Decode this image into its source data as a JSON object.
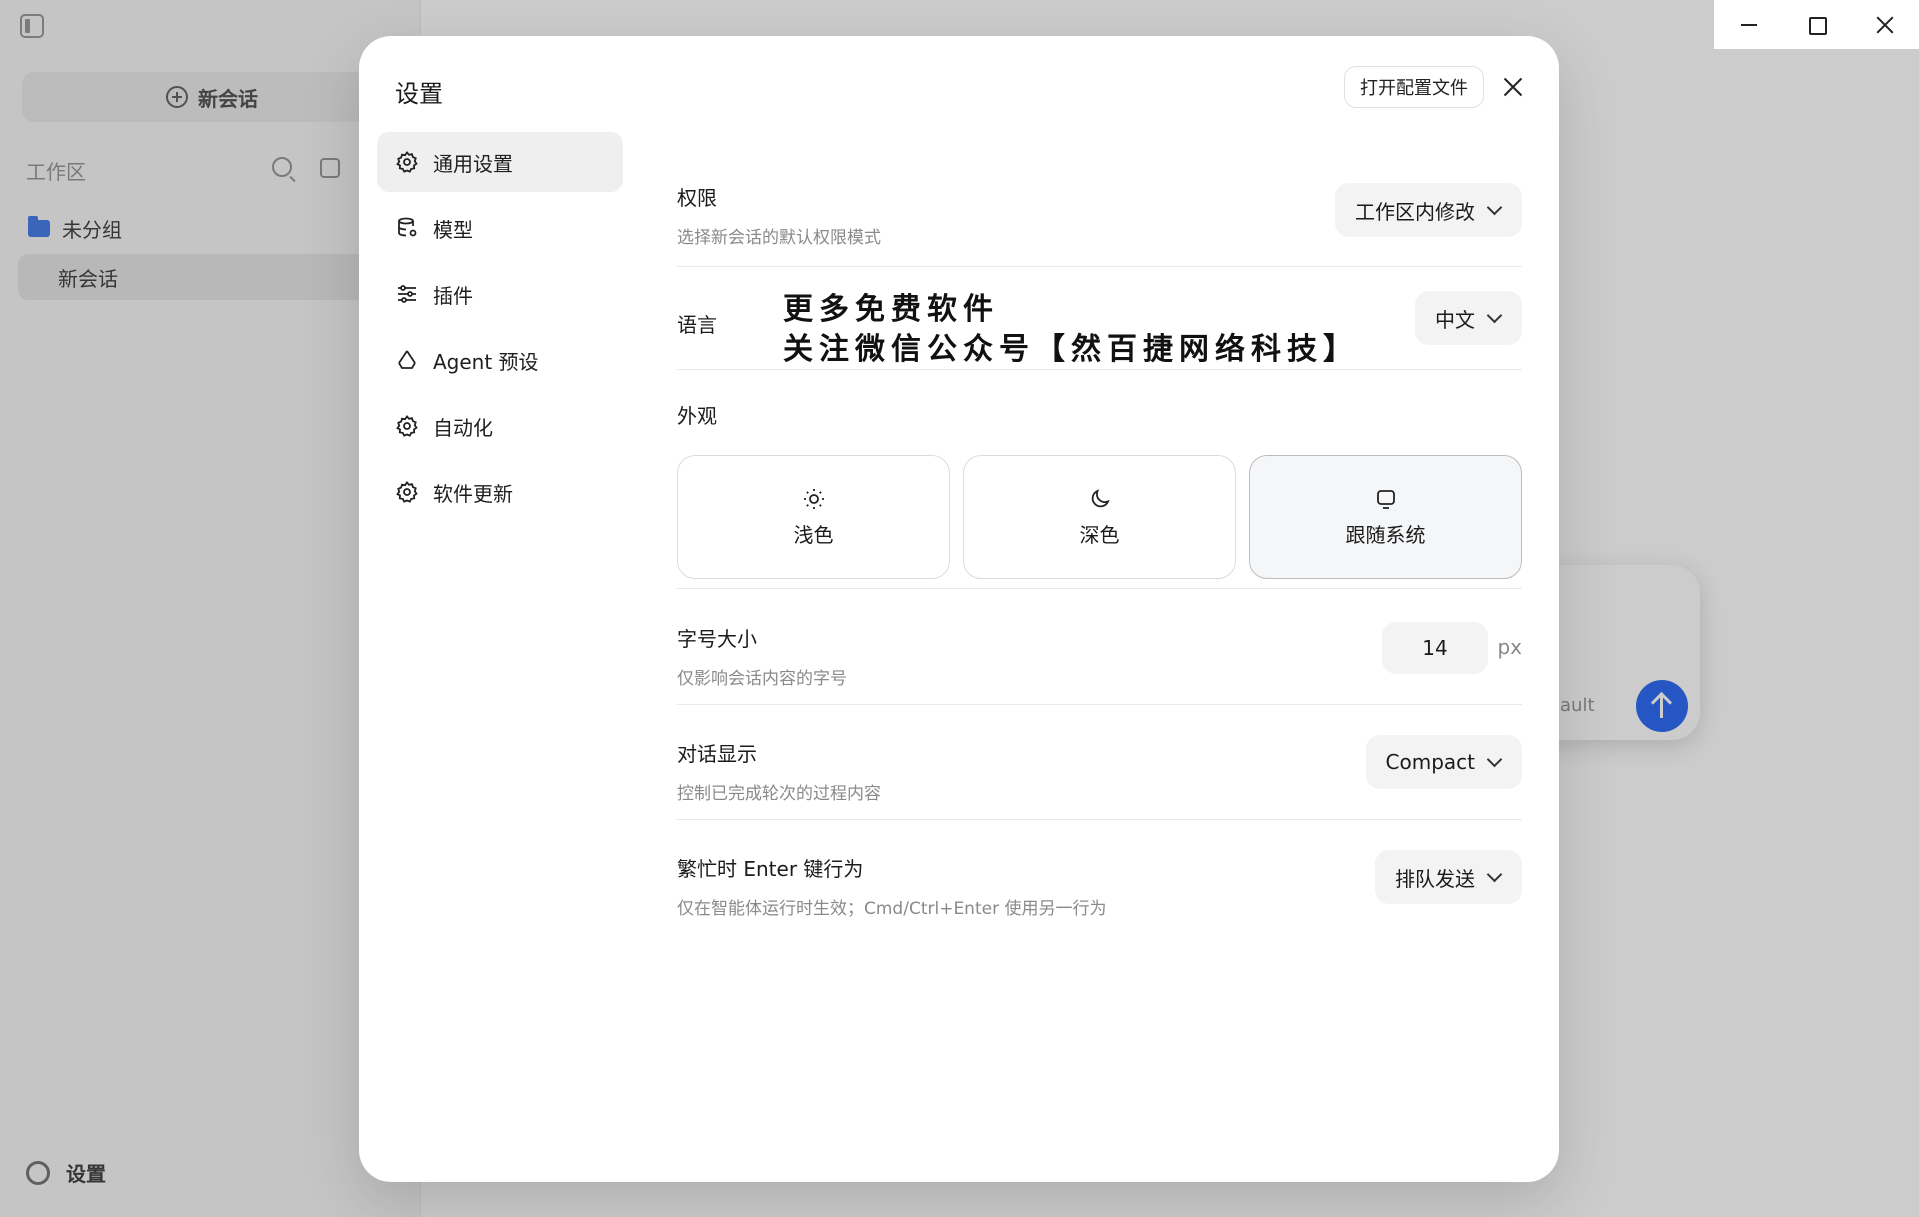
{
  "background": {
    "new_chat_label": "新会话",
    "workspace_label": "工作区",
    "folder_label": "未分组",
    "session_label": "新会话",
    "settings_label": "设置",
    "composer_model_hint": "ault"
  },
  "modal": {
    "title": "设置",
    "open_config_label": "打开配置文件",
    "nav": [
      {
        "label": "通用设置",
        "icon": "gear-icon",
        "active": true
      },
      {
        "label": "模型",
        "icon": "database-icon",
        "active": false
      },
      {
        "label": "插件",
        "icon": "sliders-icon",
        "active": false
      },
      {
        "label": "Agent 预设",
        "icon": "recycle-icon",
        "active": false
      },
      {
        "label": "自动化",
        "icon": "gear-icon",
        "active": false
      },
      {
        "label": "软件更新",
        "icon": "gear-icon",
        "active": false
      }
    ],
    "permissions": {
      "title": "权限",
      "description": "选择新会话的默认权限模式",
      "value": "工作区内修改"
    },
    "language": {
      "title": "语言",
      "value": "中文"
    },
    "appearance": {
      "title": "外观",
      "options": [
        {
          "label": "浅色",
          "icon": "sun-icon",
          "selected": false
        },
        {
          "label": "深色",
          "icon": "moon-icon",
          "selected": false
        },
        {
          "label": "跟随系统",
          "icon": "monitor-icon",
          "selected": true
        }
      ]
    },
    "font_size": {
      "title": "字号大小",
      "description": "仅影响会话内容的字号",
      "value": "14",
      "unit": "px"
    },
    "conversation_display": {
      "title": "对话显示",
      "description": "控制已完成轮次的过程内容",
      "value": "Compact"
    },
    "busy_enter": {
      "title": "繁忙时 Enter 键行为",
      "description": "仅在智能体运行时生效；Cmd/Ctrl+Enter 使用另一行为",
      "value": "排队发送"
    }
  },
  "watermark": {
    "line1": "更多免费软件",
    "line2": "关注微信公众号【然百捷网络科技】"
  }
}
